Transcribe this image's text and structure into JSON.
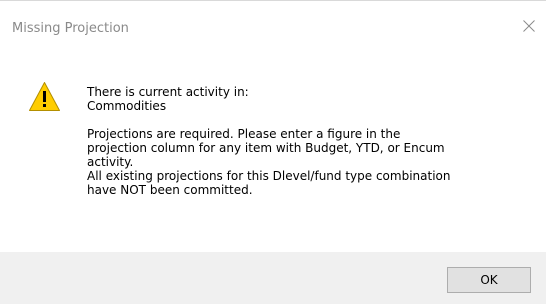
{
  "window": {
    "title": "Missing Projection",
    "close_icon": "close-icon"
  },
  "icon": {
    "type": "warning-icon",
    "color": "#ffcd00",
    "glyph": "!"
  },
  "message": {
    "lines_group1": [
      "There is current activity in:",
      "Commodities"
    ],
    "lines_group2": [
      "Projections are required. Please enter a figure in the",
      "projection column for any item with Budget, YTD, or Encum",
      "activity.",
      "All existing projections for this Dlevel/fund type combination",
      "have NOT been committed."
    ]
  },
  "buttons": {
    "ok_label": "OK"
  },
  "colors": {
    "title_text": "#8a8a8a",
    "footer_background": "#f0f0f0",
    "button_background": "#e1e1e1",
    "button_border": "#adadad"
  }
}
